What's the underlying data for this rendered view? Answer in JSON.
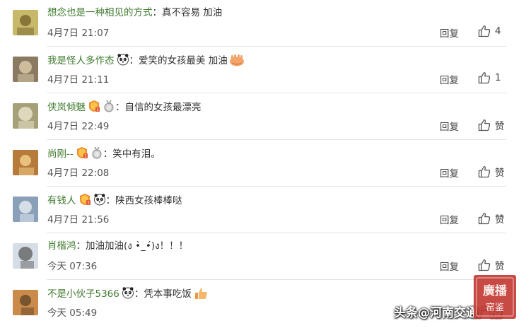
{
  "comments": [
    {
      "username": "想念也是一种相见的方式",
      "badges": [],
      "text": "真不容易  加油",
      "emoji": "",
      "time": "4月7日 21:07",
      "reply": "回复",
      "likes": "4",
      "avatar": {
        "bg": "#c8b86a",
        "fg": "#7a6a30"
      }
    },
    {
      "username": "我是怪人多作态",
      "badges": [
        "panda-icon"
      ],
      "text": "爱笑的女孩最美 加油",
      "emoji": "hands-emoji",
      "time": "4月7日 21:11",
      "reply": "回复",
      "likes": "1",
      "avatar": {
        "bg": "#8a7a62",
        "fg": "#d9c8a8"
      }
    },
    {
      "username": "侠岚倾魅",
      "badges": [
        "level-badge-icon",
        "medal-icon"
      ],
      "text": "自信的女孩最漂亮",
      "emoji": "",
      "time": "4月7日 22:49",
      "reply": "回复",
      "likes": "赞",
      "avatar": {
        "bg": "#a6a079",
        "fg": "#e8e2c8"
      }
    },
    {
      "username": "尚刚--",
      "badges": [
        "level-badge-icon",
        "medal-icon"
      ],
      "text": "笑中有泪。",
      "emoji": "",
      "time": "4月7日 22:08",
      "reply": "回复",
      "likes": "赞",
      "avatar": {
        "bg": "#b67a3a",
        "fg": "#f2cc8a"
      }
    },
    {
      "username": "有钱人",
      "badges": [
        "level-badge-icon",
        "panda-icon"
      ],
      "text": "陕西女孩棒棒哒",
      "emoji": "",
      "time": "4月7日 21:56",
      "reply": "回复",
      "likes": "赞",
      "avatar": {
        "bg": "#8aa0b8",
        "fg": "#e2e8ee"
      }
    },
    {
      "username": "肖楷鸿",
      "badges": [],
      "text": "加油加油(ง •̀_•́)ง！！！",
      "emoji": "",
      "time": "今天 07:36",
      "reply": "回复",
      "likes": "赞",
      "avatar": {
        "bg": "#d6dde6",
        "fg": "#6a6a6a"
      }
    },
    {
      "username": "不是小伙子5366",
      "badges": [
        "panda-icon"
      ],
      "text": "凭本事吃饭",
      "emoji": "thumbs-up-emoji",
      "time": "今天 05:49",
      "reply": "",
      "likes": "",
      "avatar": {
        "bg": "#c98a4a",
        "fg": "#6a4a2a"
      }
    }
  ],
  "colon": "：",
  "watermark": {
    "text": "头条@河南交通广播",
    "seal_text": "廣播",
    "seal_color": "#c0312b"
  },
  "colors": {
    "username": "#3e7a2e",
    "text": "#333333",
    "meta": "#555555",
    "divider": "#e3e3e3"
  }
}
